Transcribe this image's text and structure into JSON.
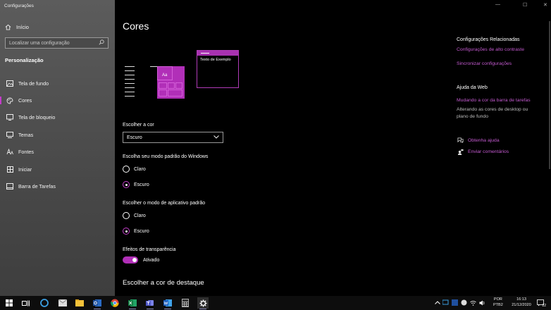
{
  "app_title": "Configurações",
  "sidebar": {
    "home_label": "Início",
    "search_placeholder": "Localizar uma configuração",
    "section_title": "Personalização",
    "items": [
      {
        "label": "Tela de fundo",
        "icon": "picture-icon"
      },
      {
        "label": "Cores",
        "icon": "palette-icon",
        "active": true
      },
      {
        "label": "Tela de bloqueio",
        "icon": "lock-screen-icon"
      },
      {
        "label": "Temas",
        "icon": "brush-icon"
      },
      {
        "label": "Fontes",
        "icon": "font-icon"
      },
      {
        "label": "Iniciar",
        "icon": "start-icon"
      },
      {
        "label": "Barra de Tarefas",
        "icon": "taskbar-icon"
      }
    ]
  },
  "main": {
    "title": "Cores",
    "preview_tile_text": "Aa",
    "preview_sample_text": "Texto de Exemplo",
    "choose_color_label": "Escolher a cor",
    "choose_color_value": "Escuro",
    "windows_mode_label": "Escolha seu modo padrão do Windows",
    "windows_mode_options": [
      "Claro",
      "Escuro"
    ],
    "windows_mode_selected": "Escuro",
    "app_mode_label": "Escolher o modo de aplicativo padrão",
    "app_mode_options": [
      "Claro",
      "Escuro"
    ],
    "app_mode_selected": "Escuro",
    "transparency_label": "Efeitos de transparência",
    "transparency_state": "Ativado",
    "accent_title": "Escolher a cor de destaque"
  },
  "related": {
    "title": "Configurações Relacionadas",
    "links": [
      "Configurações de alto contraste",
      "Sincronizar configurações"
    ]
  },
  "web_help": {
    "title": "Ajuda da Web",
    "link": "Mudando a cor da barra de tarefas",
    "text": "Alterando as cores de desktop ou plano de fundo"
  },
  "support": {
    "get_help": "Obtenha ajuda",
    "feedback": "Enviar comentários"
  },
  "taskbar": {
    "apps": [
      "start-icon",
      "task-view-icon",
      "edge-icon",
      "mail-icon",
      "outlook-icon",
      "file-explorer-icon",
      "folder-icon",
      "chrome-icon",
      "excel-icon",
      "teams-icon",
      "word-icon",
      "calculator-icon",
      "settings-icon"
    ],
    "lang_line1": "POR",
    "lang_line2": "PTB2",
    "time": "16:13",
    "date": "21/12/2020",
    "notification_count": "22"
  },
  "colors": {
    "accent": "#b12fb8",
    "accent_link": "#c45ad0",
    "sidebar": "#555555"
  }
}
